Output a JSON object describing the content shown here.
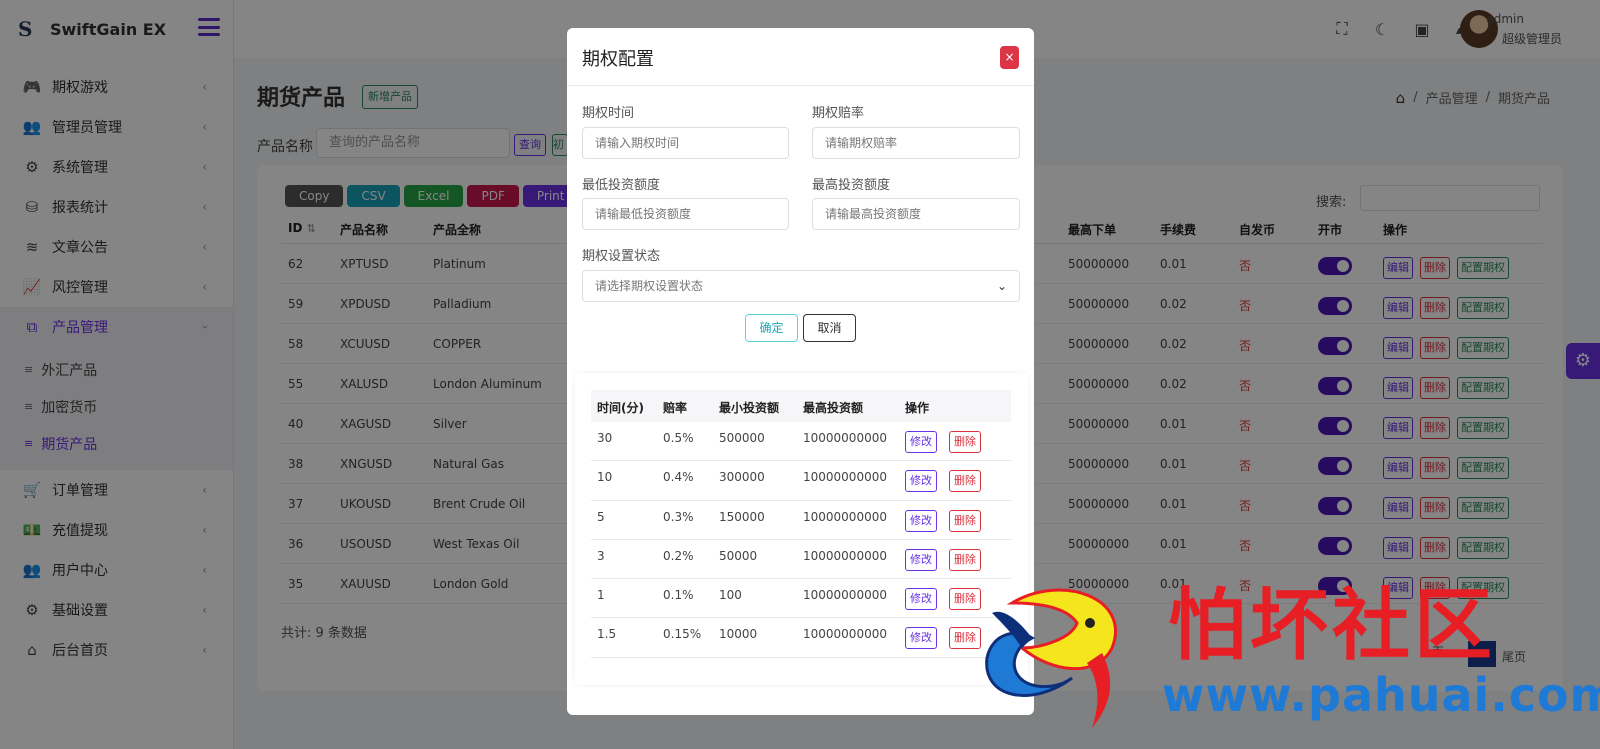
{
  "brand": {
    "name": "SwiftGain EX",
    "logo": "S"
  },
  "sidebar": {
    "items": [
      {
        "label": "期权游戏",
        "icon": "gamepad-icon",
        "glyph": "🎮"
      },
      {
        "label": "管理员管理",
        "icon": "users-icon",
        "glyph": "👥"
      },
      {
        "label": "系统管理",
        "icon": "gear-icon",
        "glyph": "⚙"
      },
      {
        "label": "报表统计",
        "icon": "database-icon",
        "glyph": "⛁"
      },
      {
        "label": "文章公告",
        "icon": "layers-icon",
        "glyph": "≋"
      },
      {
        "label": "风控管理",
        "icon": "chart-line-icon",
        "glyph": "📈"
      },
      {
        "label": "产品管理",
        "icon": "cubes-icon",
        "glyph": "⧉"
      }
    ],
    "submenu": [
      {
        "label": "外汇产品"
      },
      {
        "label": "加密货币"
      },
      {
        "label": "期货产品"
      }
    ],
    "items_after": [
      {
        "label": "订单管理",
        "icon": "cart-icon",
        "glyph": "🛒"
      },
      {
        "label": "充值提现",
        "icon": "money-icon",
        "glyph": "💵"
      },
      {
        "label": "用户中心",
        "icon": "user-group-icon",
        "glyph": "👥"
      },
      {
        "label": "基础设置",
        "icon": "cogs-icon",
        "glyph": "⚙"
      },
      {
        "label": "后台首页",
        "icon": "home-icon",
        "glyph": "⌂"
      }
    ]
  },
  "topbar": {
    "icons": [
      "fullscreen-icon",
      "moon-icon",
      "money-icon",
      "chat-icon"
    ],
    "user_name": "admin",
    "user_role": "超级管理员"
  },
  "page": {
    "title": "期货产品",
    "add_label": "新增产品",
    "breadcrumb": [
      "产品管理",
      "期货产品"
    ],
    "filter_label": "产品名称",
    "filter_placeholder": "查询的产品名称",
    "query_label": "查询",
    "reset_label": "初",
    "export": [
      {
        "label": "Copy",
        "color": "#555555"
      },
      {
        "label": "CSV",
        "color": "#17a2b8"
      },
      {
        "label": "Excel",
        "color": "#28a745"
      },
      {
        "label": "PDF",
        "color": "#c8174f"
      },
      {
        "label": "Print",
        "color": "#6a31e6"
      }
    ],
    "search_label": "搜索:",
    "total": "共计: 9 条数据",
    "pager_prev": "页",
    "pager_last": "尾页"
  },
  "table": {
    "headers": {
      "id": "ID",
      "name": "产品名称",
      "fullname": "产品全称",
      "max_order": "最高下单",
      "fee": "手续费",
      "self_issue": "自发币",
      "open": "开市",
      "ops": "操作"
    },
    "rows": [
      {
        "id": "62",
        "name": "XPTUSD",
        "fullname": "Platinum",
        "max_order": "50000000",
        "fee": "0.01",
        "self_issue": "否"
      },
      {
        "id": "59",
        "name": "XPDUSD",
        "fullname": "Palladium",
        "max_order": "50000000",
        "fee": "0.02",
        "self_issue": "否"
      },
      {
        "id": "58",
        "name": "XCUUSD",
        "fullname": "COPPER",
        "max_order": "50000000",
        "fee": "0.02",
        "self_issue": "否"
      },
      {
        "id": "55",
        "name": "XALUSD",
        "fullname": "London Aluminum",
        "max_order": "50000000",
        "fee": "0.02",
        "self_issue": "否"
      },
      {
        "id": "40",
        "name": "XAGUSD",
        "fullname": "Silver",
        "max_order": "50000000",
        "fee": "0.01",
        "self_issue": "否"
      },
      {
        "id": "38",
        "name": "XNGUSD",
        "fullname": "Natural Gas",
        "max_order": "50000000",
        "fee": "0.01",
        "self_issue": "否"
      },
      {
        "id": "37",
        "name": "UKOUSD",
        "fullname": "Brent Crude Oil",
        "max_order": "50000000",
        "fee": "0.01",
        "self_issue": "否"
      },
      {
        "id": "36",
        "name": "USOUSD",
        "fullname": "West Texas Oil",
        "max_order": "50000000",
        "fee": "0.01",
        "self_issue": "否"
      },
      {
        "id": "35",
        "name": "XAUUSD",
        "fullname": "London Gold",
        "max_order": "50000000",
        "fee": "0.01",
        "self_issue": "否"
      }
    ],
    "btn_edit": "编辑",
    "btn_delete": "删除",
    "btn_config": "配置期权"
  },
  "modal": {
    "title": "期权配置",
    "close": "×",
    "fields": {
      "time_label": "期权时间",
      "time_placeholder": "请输入期权时间",
      "rate_label": "期权赔率",
      "rate_placeholder": "请输期权赔率",
      "min_label": "最低投资额度",
      "min_placeholder": "请输最低投资额度",
      "max_label": "最高投资额度",
      "max_placeholder": "请输最高投资额度",
      "status_label": "期权设置状态",
      "status_placeholder": "请选择期权设置状态"
    },
    "ok": "确定",
    "cancel": "取消",
    "options_table": {
      "headers": {
        "time": "时间(分)",
        "rate": "赔率",
        "min": "最小投资额",
        "max": "最高投资额",
        "ops": "操作"
      },
      "rows": [
        {
          "time": "30",
          "rate": "0.5%",
          "min": "500000",
          "max": "10000000000"
        },
        {
          "time": "10",
          "rate": "0.4%",
          "min": "300000",
          "max": "10000000000"
        },
        {
          "time": "5",
          "rate": "0.3%",
          "min": "150000",
          "max": "10000000000"
        },
        {
          "time": "3",
          "rate": "0.2%",
          "min": "50000",
          "max": "10000000000"
        },
        {
          "time": "1",
          "rate": "0.1%",
          "min": "100",
          "max": "10000000000"
        },
        {
          "time": "1.5",
          "rate": "0.15%",
          "min": "10000",
          "max": "10000000000"
        }
      ],
      "btn_edit": "修改",
      "btn_delete": "删除"
    }
  },
  "watermark": {
    "text": "怕坏社区",
    "url": "www.pahuai.com"
  }
}
